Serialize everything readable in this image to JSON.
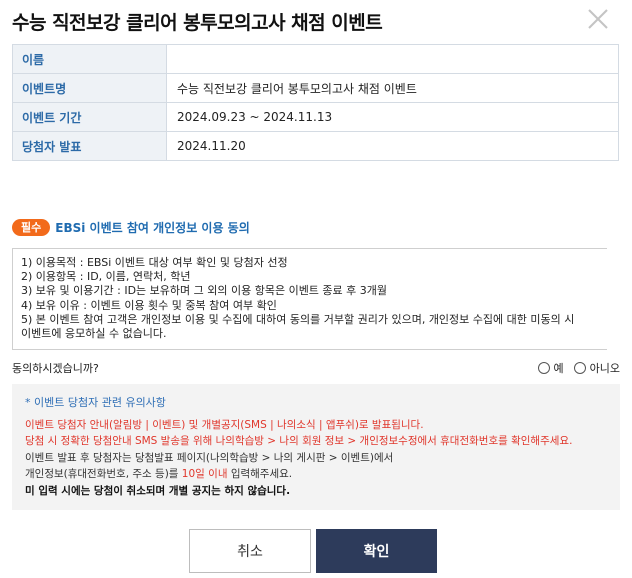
{
  "modal": {
    "title": "수능 직전보강 클리어 봉투모의고사 채점 이벤트",
    "close_icon": "close-icon"
  },
  "info_table": [
    {
      "label": "이름",
      "value": ""
    },
    {
      "label": "이벤트명",
      "value": "수능 직전보강 클리어 봉투모의고사 채점 이벤트"
    },
    {
      "label": "이벤트 기간",
      "value": "2024.09.23 ~ 2024.11.13"
    },
    {
      "label": "당첨자 발표",
      "value": "2024.11.20"
    }
  ],
  "consent": {
    "badge": "필수",
    "title": "EBSi 이벤트 참여 개인정보 이용 동의",
    "lines": [
      "1) 이용목적 : EBSi 이벤트 대상 여부 확인 및 당첨자 선정",
      "2) 이용항목 : ID, 이름, 연락처, 학년",
      "3) 보유 및 이용기간 : ID는 보유하며 그 외의 이용 항목은 이벤트 종료 후 3개월",
      "4) 보유 이유 : 이벤트 이용 횟수 및 중복 참여 여부 확인",
      "5) 본 이벤트 참여 고객은 개인정보 이용 및 수집에 대하여 동의를 거부할 권리가 있으며, 개인정보 수집에 대한 미동의 시",
      "이벤트에 응모하실 수 없습니다."
    ],
    "question": "동의하시겠습니까?",
    "option_yes": "예",
    "option_no": "아니오"
  },
  "notice": {
    "heading": "* 이벤트 당첨자 관련 유의사항",
    "line1": "이벤트 당첨자 안내(알림방 | 이벤트) 및 개별공지(SMS | 나의소식 | 앱푸쉬)로 발표됩니다.",
    "line2": "당첨 시 정확한 당첨안내 SMS 발송을 위해 나의학습방 > 나의 회원 정보 > 개인정보수정에서 휴대전화번호를 확인해주세요.",
    "line3": "이벤트 발표 후 당첨자는 당첨발표 페이지(나의학습방 > 나의 게시판 > 이벤트)에서",
    "line4_a": "개인정보(휴대전화번호, 주소 등)를 ",
    "line4_b": "10일 이내",
    "line4_c": " 입력해주세요.",
    "line5": "미 입력 시에는 당첨이 취소되며 개별 공지는 하지 않습니다."
  },
  "buttons": {
    "cancel": "취소",
    "confirm": "확인"
  },
  "colors": {
    "badge": "#f26a1b",
    "label_text": "#2c6aa7",
    "confirm_bg": "#2d3b5b",
    "warn_red": "#e0362b"
  }
}
